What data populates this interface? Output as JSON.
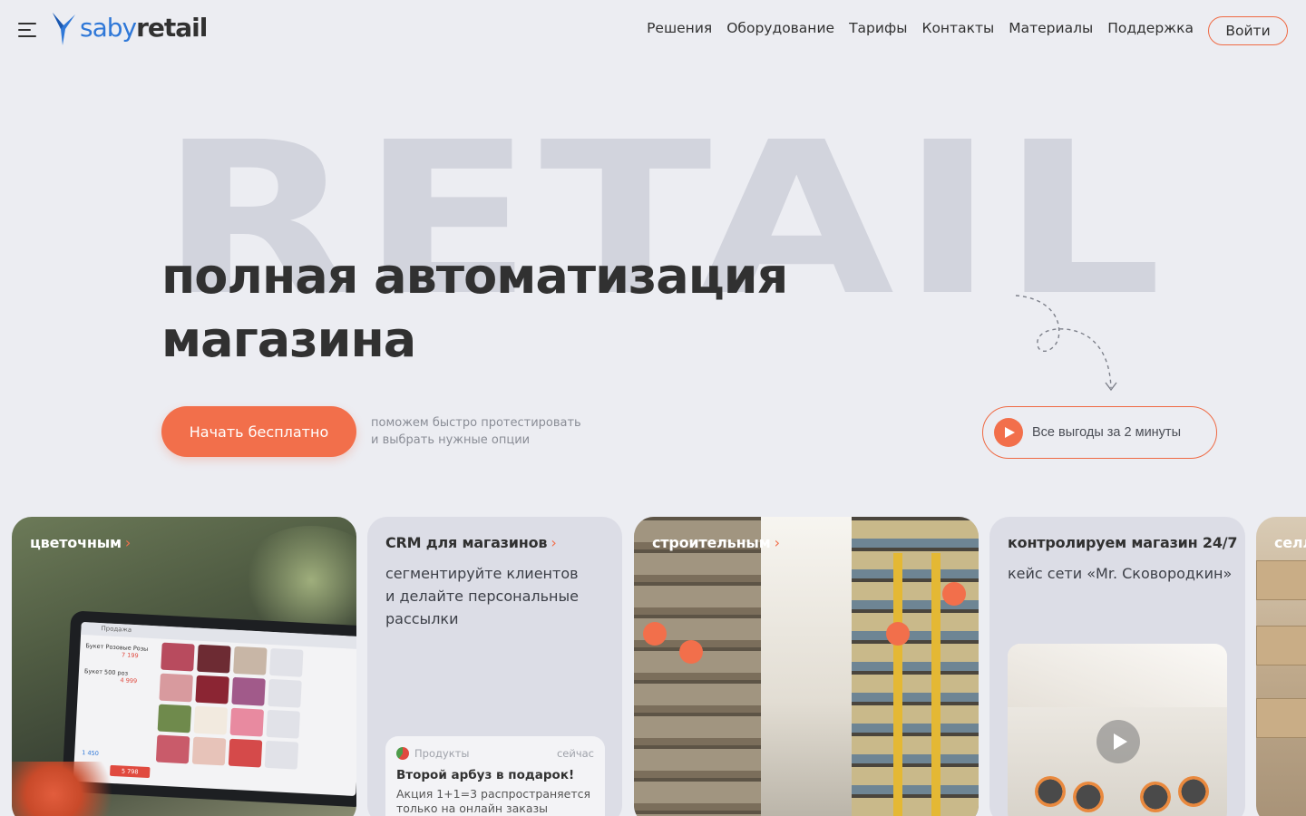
{
  "header": {
    "logo": {
      "part1": "saby",
      "part2": "retail"
    },
    "nav": [
      "Решения",
      "Оборудование",
      "Тарифы",
      "Контакты",
      "Материалы",
      "Поддержка"
    ],
    "login_label": "Войти"
  },
  "hero": {
    "background_word": "RETAIL",
    "title_line1": "полная автоматизация",
    "title_line2": "магазина",
    "cta_label": "Начать бесплатно",
    "cta_note_line1": "поможем быстро протестировать",
    "cta_note_line2": "и выбрать нужные опции",
    "video_label": "Все выгоды за 2 минуты"
  },
  "cards": {
    "flower": {
      "caption": "цветочным",
      "screen_title": "Продажа",
      "screen_item1": "Букет Розовые Розы",
      "screen_price1": "7 199",
      "screen_item2": "Букет 500 роз",
      "screen_price2": "4 999",
      "screen_total": "1 450",
      "screen_pay": "5 798"
    },
    "crm": {
      "caption": "CRM для магазинов",
      "sub_line1": "сегментируйте клиентов",
      "sub_line2": "и делайте персональные",
      "sub_line3": "рассылки",
      "notif_app": "Продукты",
      "notif_time": "сейчас",
      "notif_title": "Второй арбуз в подарок!",
      "notif_line1": "Акция 1+1=3 распространяется",
      "notif_line2": "только на онлайн заказы"
    },
    "building": {
      "caption": "строительным"
    },
    "case": {
      "caption": "контролируем магазин 24/7",
      "sub": "кейс сети «Mr. Сковородкин»"
    },
    "partial": {
      "caption": "селл"
    }
  },
  "colors": {
    "accent": "#f26f4b",
    "brand_blue": "#2f78d8",
    "background": "#ecedf2",
    "text": "#313131"
  },
  "icons": [
    "menu-icon",
    "logo-bird-icon",
    "play-icon",
    "chevron-right-icon",
    "video-play-icon"
  ]
}
